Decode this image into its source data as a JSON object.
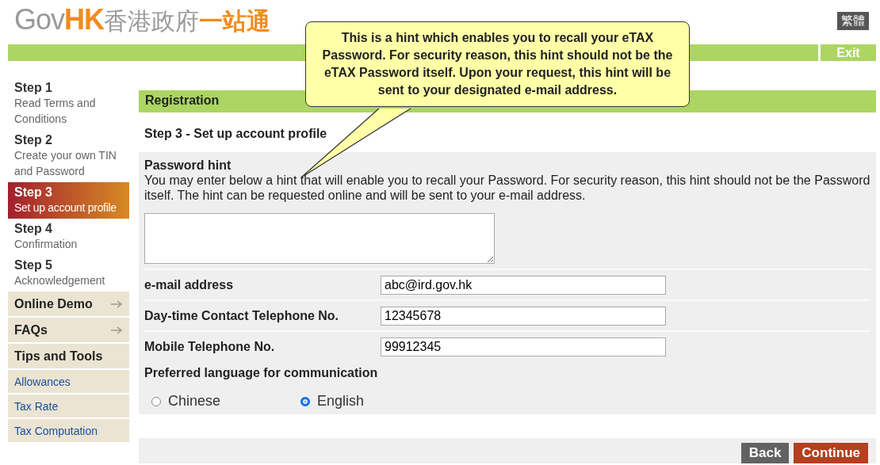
{
  "header": {
    "logo_latin_grey": "Gov",
    "logo_latin_orange": "HK",
    "logo_chinese_grey": "香港政府",
    "logo_chinese_orange": "一站通",
    "language_button": "繁體",
    "exit_button": "Exit"
  },
  "tooltip": {
    "text": "This is a hint which enables you to recall your eTAX Password. For security reason, this hint should not be the eTAX Password itself. Upon your request, this hint will be sent to your designated e-mail address."
  },
  "steps": [
    {
      "title": "Step 1",
      "subtitle": "Read Terms and Conditions",
      "selected": false
    },
    {
      "title": "Step 2",
      "subtitle": "Create your own TIN and Password",
      "selected": false
    },
    {
      "title": "Step 3",
      "subtitle": "Set up account profile",
      "selected": true
    },
    {
      "title": "Step 4",
      "subtitle": "Confirmation",
      "selected": false
    },
    {
      "title": "Step 5",
      "subtitle": "Acknowledgement",
      "selected": false
    }
  ],
  "sidebar_menu": [
    {
      "label": "Online Demo",
      "kind": "expandable"
    },
    {
      "label": "FAQs",
      "kind": "expandable"
    },
    {
      "label": "Tips and Tools",
      "kind": "heading"
    },
    {
      "label": "Allowances",
      "kind": "link"
    },
    {
      "label": "Tax Rate",
      "kind": "link"
    },
    {
      "label": "Tax Computation",
      "kind": "link"
    }
  ],
  "section_title": "Registration",
  "step_heading": "Step 3 - Set up account profile",
  "password_hint": {
    "label": "Password hint",
    "description": "You may enter below a hint that will enable you to recall your Password. For security reason, this hint should not be the Password itself. The hint can be requested online and will be sent to your e-mail address."
  },
  "fields": [
    {
      "label": "e-mail address",
      "value": "abc@ird.gov.hk"
    },
    {
      "label": "Day-time Contact Telephone No.",
      "value": "12345678"
    },
    {
      "label": "Mobile Telephone No.",
      "value": "99912345"
    }
  ],
  "language": {
    "label": "Preferred language for communication",
    "options": [
      {
        "label": "Chinese",
        "selected": false
      },
      {
        "label": "English",
        "selected": true
      }
    ]
  },
  "buttons": [
    {
      "label": "Back",
      "kind": "secondary"
    },
    {
      "label": "Continue",
      "kind": "primary"
    }
  ]
}
